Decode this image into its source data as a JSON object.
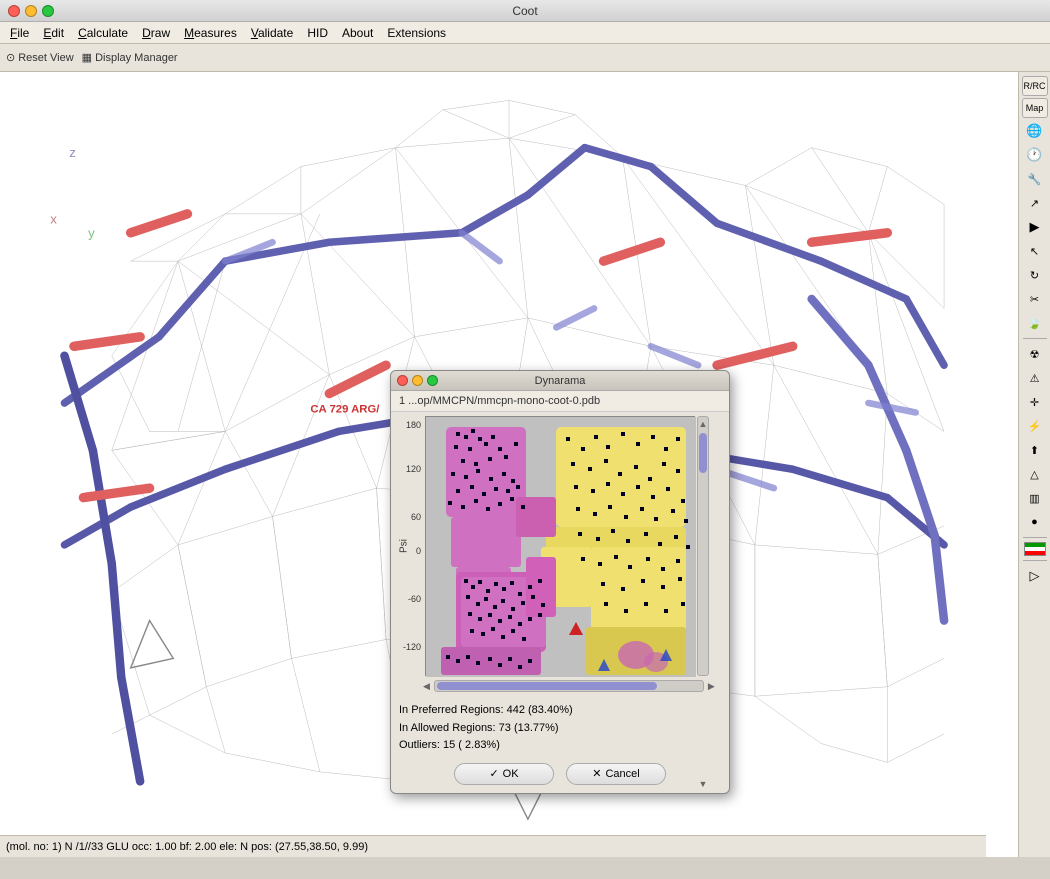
{
  "titleBar": {
    "title": "Coot"
  },
  "menuBar": {
    "items": [
      {
        "label": "File",
        "underline": true
      },
      {
        "label": "Edit",
        "underline": true
      },
      {
        "label": "Calculate",
        "underline": true
      },
      {
        "label": "Draw",
        "underline": true
      },
      {
        "label": "Measures",
        "underline": true
      },
      {
        "label": "Validate",
        "underline": true
      },
      {
        "label": "HID",
        "underline": false
      },
      {
        "label": "About",
        "underline": false
      },
      {
        "label": "Extensions",
        "underline": false
      }
    ]
  },
  "toolbar": {
    "resetView": "Reset View",
    "displayManager": "Display Manager"
  },
  "rightToolbar": {
    "rcLabel": "R/RC",
    "mapLabel": "Map"
  },
  "dialog": {
    "title": "Dynarama",
    "path": "1 ...op/MMCPN/mmcpn-mono-coot-0.pdb",
    "stats": {
      "preferred": "In Preferred Regions:  442  (83.40%)",
      "allowed": "In Allowed Regions:  73  (13.77%)",
      "outliers": "Outliers:  15  ( 2.83%)"
    },
    "okLabel": "OK",
    "cancelLabel": "Cancel",
    "checkmark": "✓",
    "cross": "✕"
  },
  "ramachandran": {
    "yLabels": [
      "180",
      "120",
      "60",
      "0",
      "-60",
      "-120"
    ],
    "psiLabel": "Psi"
  },
  "statusBar": {
    "text": "(mol. no: 1)  N  /1//33 GLU occ:  1.00 bf:  2.00 ele:  N pos: (27.55,38.50, 9.99)"
  },
  "molecule": {
    "label": "CA 729 ARG/"
  }
}
